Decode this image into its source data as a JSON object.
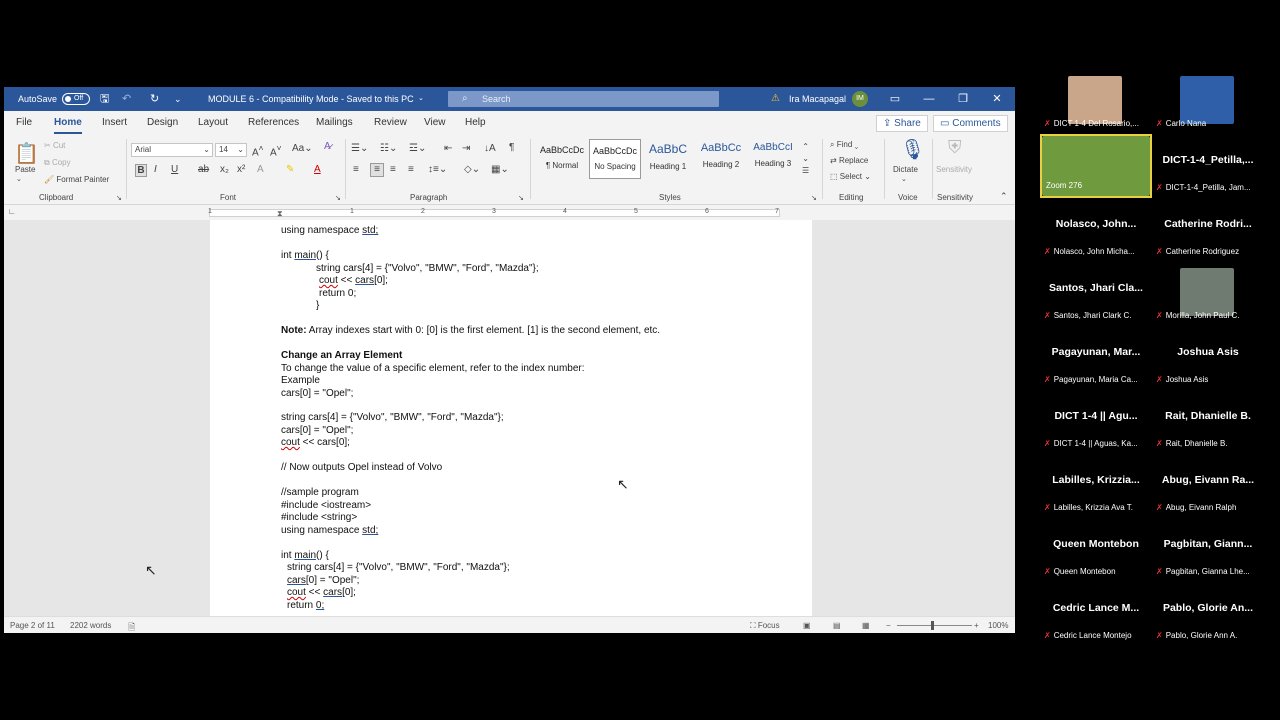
{
  "titlebar": {
    "autosave_label": "AutoSave",
    "autosave_state": "Off",
    "doc_title": "MODULE 6  -  Compatibility Mode  -  Saved to this PC",
    "search_placeholder": "Search",
    "user_name": "Ira Macapagal",
    "user_initials": "IM"
  },
  "tabs": [
    "File",
    "Home",
    "Insert",
    "Design",
    "Layout",
    "References",
    "Mailings",
    "Review",
    "View",
    "Help"
  ],
  "share_label": "Share",
  "comments_label": "Comments",
  "ribbon": {
    "clipboard": {
      "paste": "Paste",
      "cut": "Cut",
      "copy": "Copy",
      "format_painter": "Format Painter",
      "group": "Clipboard"
    },
    "font": {
      "name": "Arial",
      "size": "14",
      "group": "Font"
    },
    "paragraph": {
      "group": "Paragraph"
    },
    "styles": {
      "items": [
        {
          "preview": "AaBbCcDc",
          "name": "¶ Normal"
        },
        {
          "preview": "AaBbCcDc",
          "name": "No Spacing"
        },
        {
          "preview": "AaBbC",
          "name": "Heading 1"
        },
        {
          "preview": "AaBbCc",
          "name": "Heading 2"
        },
        {
          "preview": "AaBbCcI",
          "name": "Heading 3"
        }
      ],
      "group": "Styles"
    },
    "editing": {
      "find": "Find",
      "replace": "Replace",
      "select": "Select",
      "group": "Editing"
    },
    "voice": {
      "dictate": "Dictate",
      "group": "Voice"
    },
    "sensitivity": {
      "label": "Sensitivity",
      "group": "Sensitivity"
    }
  },
  "ruler_numbers": [
    "1",
    "1",
    "2",
    "3",
    "4",
    "5",
    "6",
    "7"
  ],
  "document": {
    "line1": "using namespace std;",
    "line2": "int main() {",
    "line3": "string cars[4] = {\"Volvo\", \"BMW\", \"Ford\", \"Mazda\"};",
    "line4": "cout << cars[0];",
    "line5": "return 0;",
    "line6": "}",
    "note_bold": "Note:",
    "note_text": " Array indexes start with 0: [0] is the first element. [1] is the second element, etc.",
    "heading": "Change an Array Element",
    "para": "To change the value of a specific element, refer to the index number:",
    "example": "Example",
    "ex1": "cars[0] = \"Opel\";",
    "ex2": "string cars[4] = {\"Volvo\", \"BMW\", \"Ford\", \"Mazda\"};",
    "ex3": "cars[0] = \"Opel\";",
    "ex4": "cout << cars[0];",
    "comment": "// Now outputs Opel instead of Volvo",
    "s1": "//sample program",
    "s2": "#include <iostream>",
    "s3": "#include <string>",
    "s4": "using namespace std;",
    "s5": "int main() {",
    "s6": "string cars[4] = {\"Volvo\", \"BMW\", \"Ford\", \"Mazda\"};",
    "s7": "cars[0] = \"Opel\";",
    "s8": "cout << cars[0];",
    "s9": "return 0;"
  },
  "status": {
    "page": "Page 2 of 11",
    "words": "2202 words",
    "focus": "Focus",
    "zoom": "100%"
  },
  "participants": [
    {
      "big": "",
      "label": "DICT 1-4 Del Rosario,...",
      "photo": "#c9a68a"
    },
    {
      "big": "",
      "label": "Carlo Nana",
      "photo": "#2e5fa8"
    },
    {
      "big": "",
      "label": "Zoom 276",
      "photo": "#6f9a3e"
    },
    {
      "big": "DICT-1-4_Petilla,...",
      "label": "DICT-1-4_Petilla, Jam..."
    },
    {
      "big": "Nolasco, John...",
      "label": "Nolasco, John Micha..."
    },
    {
      "big": "Catherine Rodri...",
      "label": "Catherine Rodriguez"
    },
    {
      "big": "Santos, Jhari Cla...",
      "label": "Santos, Jhari Clark C."
    },
    {
      "big": "",
      "label": "Morilla, John Paul C.",
      "photo": "#6f7a70"
    },
    {
      "big": "Pagayunan, Mar...",
      "label": "Pagayunan, Maria Ca..."
    },
    {
      "big": "Joshua Asis",
      "label": "Joshua Asis"
    },
    {
      "big": "DICT 1-4 || Agu...",
      "label": "DICT 1-4 || Aguas, Ka..."
    },
    {
      "big": "Rait, Dhanielle B.",
      "label": "Rait, Dhanielle B."
    },
    {
      "big": "Labilles, Krizzia...",
      "label": "Labilles, Krizzia Ava T."
    },
    {
      "big": "Abug, Eivann Ra...",
      "label": "Abug, Eivann Ralph"
    },
    {
      "big": "Queen Montebon",
      "label": "Queen Montebon"
    },
    {
      "big": "Pagbitan, Giann...",
      "label": "Pagbitan, Gianna Lhe..."
    },
    {
      "big": "Cedric Lance M...",
      "label": "Cedric Lance Montejo"
    },
    {
      "big": "Pablo, Glorie An...",
      "label": "Pablo, Glorie Ann A."
    }
  ]
}
